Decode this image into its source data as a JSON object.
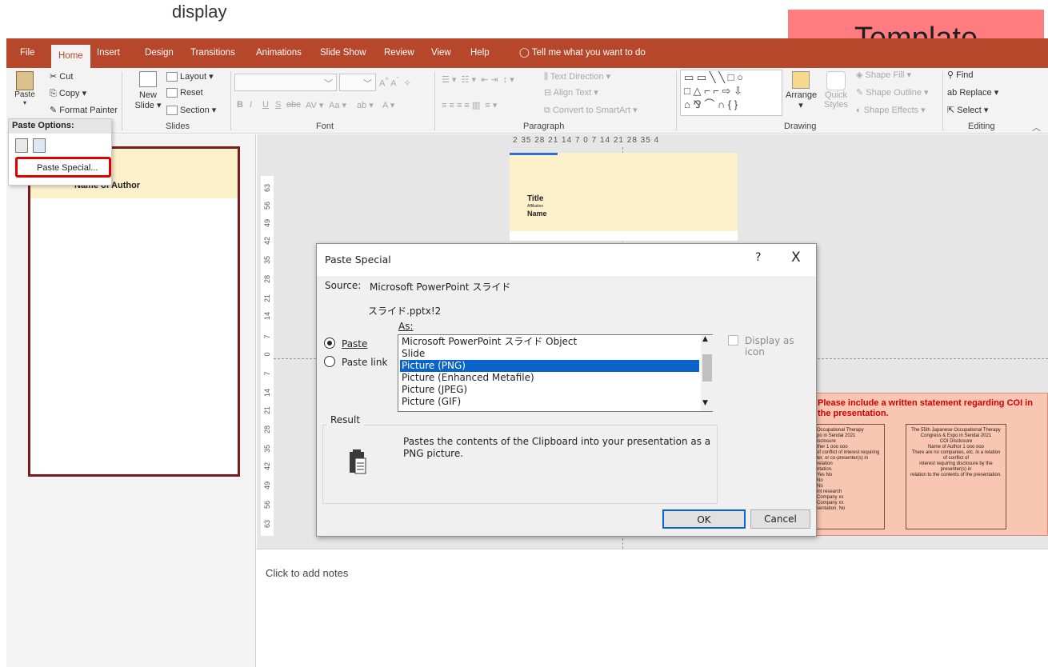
{
  "caption": "display",
  "badge": "Template",
  "tabs": [
    "File",
    "Home",
    "Insert",
    "Design",
    "Transitions",
    "Animations",
    "Slide Show",
    "Review",
    "View",
    "Help"
  ],
  "tell_me": "Tell me what you want to do",
  "clipboard": {
    "paste": "Paste",
    "cut": "Cut",
    "copy": "Copy",
    "format_painter": "Format Painter"
  },
  "slides_group": {
    "label": "Slides",
    "new_slide": "New",
    "new_slide2": "Slide",
    "layout": "Layout",
    "reset": "Reset",
    "section": "Section"
  },
  "font_group": {
    "label": "Font",
    "b": "B",
    "i": "I",
    "u": "U",
    "s": "S",
    "abc": "abc",
    "aa": "Aa",
    "a": "A"
  },
  "paragraph_group": {
    "label": "Paragraph",
    "text_direction": "Text Direction",
    "align_text": "Align Text",
    "convert": "Convert to SmartArt"
  },
  "drawing_group": {
    "label": "Drawing",
    "arrange": "Arrange",
    "quick": "Quick",
    "styles": "Styles",
    "fill": "Shape Fill",
    "outline": "Shape Outline",
    "effects": "Shape Effects"
  },
  "editing_group": {
    "label": "Editing",
    "find": "Find",
    "replace": "Replace",
    "select": "Select"
  },
  "paste_menu": {
    "title": "Paste Options:",
    "special": "Paste Special..."
  },
  "thumbnail": {
    "author": "Name of Author"
  },
  "ruler": {
    "h": "2  35  28  21  14   7   0   7  14  21  28  35  4",
    "v": [
      "63",
      "56",
      "49",
      "42",
      "35",
      "28",
      "21",
      "14",
      "7",
      "0",
      "7",
      "14",
      "21",
      "28",
      "35",
      "42",
      "49",
      "56",
      "63"
    ]
  },
  "slide": {
    "title": "Title",
    "affiliation": "Affiliation",
    "name": "Name"
  },
  "coi": {
    "note": "Please include a written statement regarding COI in the presentation.",
    "card_left": "Occupational Therapy\npo in Sendai 2021\nisclosure\nther 1  ooo ooo\nof conflict of interest requiring\nter, or co-presenter(s) in relation\nntation.\nYes   No\nNo\nNo\nint research\nCompany xx\nCompany xx\nsentation. No",
    "card_right": "The 55th Japanese Occupational Therapy\nCongress & Expo in Sendai 2021\nCOI  Disclosure\nName of Author 1  ooo ooo\nThere are no companies, etc. in a relation of conflict of\ninterest requiring disclosure by the presenter(s) in\nrelation to the contents of the presentation."
  },
  "notes": "Click to add notes",
  "dialog": {
    "title": "Paste Special",
    "help": "?",
    "close": "X",
    "source_label": "Source:",
    "source_value": "Microsoft PowerPoint スライド",
    "source_file": "スライド.pptx!2",
    "as_label": "As:",
    "paste_radio": "Paste",
    "paste_link_radio": "Paste link",
    "options": [
      "Microsoft PowerPoint スライド Object",
      "Slide",
      "Picture (PNG)",
      "Picture (Enhanced Metafile)",
      "Picture (JPEG)",
      "Picture (GIF)"
    ],
    "selected_index": 2,
    "display_as_icon": "Display as icon",
    "result_label": "Result",
    "result_text": "Pastes the contents of the Clipboard into your presentation as a PNG picture.",
    "ok": "OK",
    "cancel": "Cancel"
  },
  "colors": {
    "accent": "#b7472a",
    "highlight": "#e00000",
    "selection": "#0a63c9",
    "badge": "#ff7c80"
  }
}
